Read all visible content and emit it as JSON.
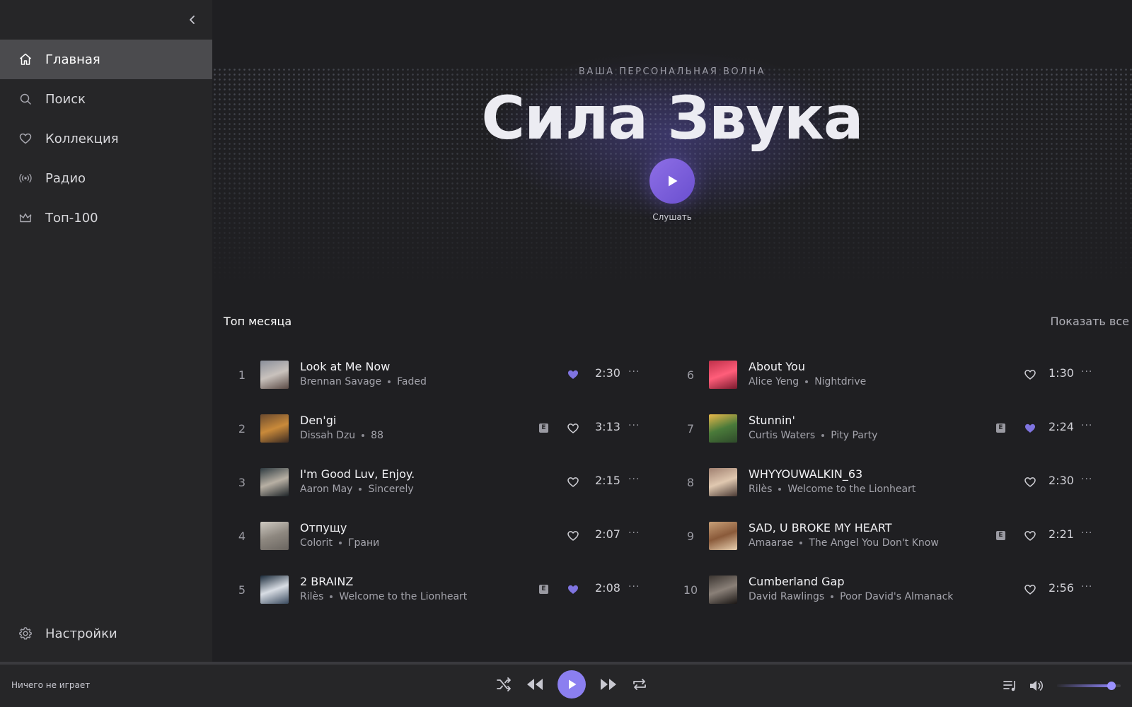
{
  "sidebar": {
    "items": [
      {
        "label": "Главная",
        "icon": "home-icon",
        "active": true
      },
      {
        "label": "Поиск",
        "icon": "search-icon",
        "active": false
      },
      {
        "label": "Коллекция",
        "icon": "heart-icon",
        "active": false
      },
      {
        "label": "Радио",
        "icon": "radio-icon",
        "active": false
      },
      {
        "label": "Топ-100",
        "icon": "crown-icon",
        "active": false
      }
    ],
    "settings_label": "Настройки"
  },
  "hero": {
    "subtitle": "ВАША ПЕРСОНАЛЬНАЯ ВОЛНА",
    "title": "Сила Звука",
    "play_label": "Слушать"
  },
  "section": {
    "title": "Топ месяца",
    "show_all": "Показать все"
  },
  "tracks": [
    {
      "num": "1",
      "title": "Look at Me Now",
      "artist": "Brennan Savage",
      "album": "Faded",
      "explicit": false,
      "liked": true,
      "duration": "2:30",
      "cover": [
        "#8a8f9a",
        "#c9c2bd",
        "#5a4a45"
      ]
    },
    {
      "num": "2",
      "title": "Den'gi",
      "artist": "Dissah Dzu",
      "album": "88",
      "explicit": true,
      "liked": false,
      "duration": "3:13",
      "cover": [
        "#6b4a2e",
        "#c98a3a",
        "#3a2a22"
      ]
    },
    {
      "num": "3",
      "title": "I'm Good Luv, Enjoy.",
      "artist": "Aaron May",
      "album": "Sincerely",
      "explicit": false,
      "liked": false,
      "duration": "2:15",
      "cover": [
        "#2e3a40",
        "#b8b0a4",
        "#1e2428"
      ]
    },
    {
      "num": "4",
      "title": "Отпущу",
      "artist": "Colorit",
      "album": "Грани",
      "explicit": false,
      "liked": false,
      "duration": "2:07",
      "cover": [
        "#cfcac2",
        "#8e8880",
        "#6a6560"
      ]
    },
    {
      "num": "5",
      "title": "2 BRAINZ",
      "artist": "Rilès",
      "album": "Welcome to the Lionheart",
      "explicit": true,
      "liked": true,
      "duration": "2:08",
      "cover": [
        "#1a2a3a",
        "#d8dde4",
        "#3a4a5e"
      ]
    },
    {
      "num": "6",
      "title": "About You",
      "artist": "Alice Yeng",
      "album": "Nightdrive",
      "explicit": false,
      "liked": false,
      "duration": "1:30",
      "cover": [
        "#c0304a",
        "#ff5e7a",
        "#7a1a2e"
      ]
    },
    {
      "num": "7",
      "title": "Stunnin'",
      "artist": "Curtis Waters",
      "album": "Pity Party",
      "explicit": true,
      "liked": true,
      "duration": "2:24",
      "cover": [
        "#e8b84a",
        "#4a7a3a",
        "#2e4a2a"
      ]
    },
    {
      "num": "8",
      "title": "WHYYOUWALKIN_63",
      "artist": "Rilès",
      "album": "Welcome to the Lionheart",
      "explicit": false,
      "liked": false,
      "duration": "2:30",
      "cover": [
        "#a08070",
        "#e0c8b0",
        "#4a3a34"
      ]
    },
    {
      "num": "9",
      "title": "SAD, U BROKE MY HEART",
      "artist": "Amaarae",
      "album": "The Angel You Don't Know",
      "explicit": true,
      "liked": false,
      "duration": "2:21",
      "cover": [
        "#c8a078",
        "#8a5a3a",
        "#e8d0b0"
      ]
    },
    {
      "num": "10",
      "title": "Cumberland Gap",
      "artist": "David Rawlings",
      "album": "Poor David's Almanack",
      "explicit": false,
      "liked": false,
      "duration": "2:56",
      "cover": [
        "#3a3430",
        "#8a8078",
        "#1a1614"
      ]
    }
  ],
  "explicit_badge": "E",
  "more_label": "···",
  "player": {
    "now_playing": "Ничего не играет",
    "volume": 0.85
  },
  "colors": {
    "accent": "#8b7ff0",
    "liked_heart": "#7f74e0",
    "sidebar_bg": "#262628",
    "active_nav_bg": "#4b4b4e"
  }
}
